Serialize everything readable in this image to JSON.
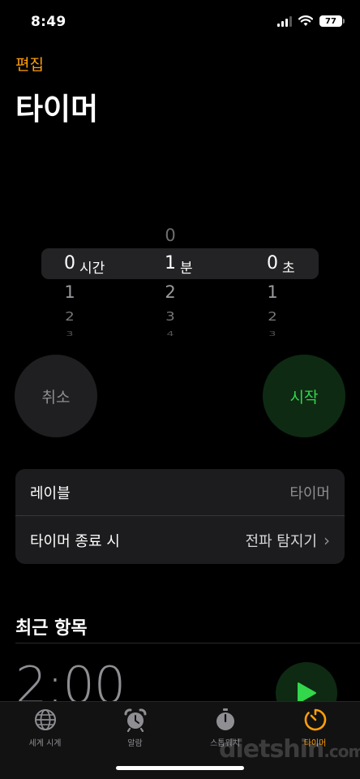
{
  "status_bar": {
    "time": "8:49",
    "battery": "77"
  },
  "header": {
    "edit_label": "편집",
    "title": "타이머"
  },
  "picker": {
    "hours": {
      "prev": "",
      "selected": "0",
      "next": [
        "1",
        "2",
        "3"
      ],
      "unit": "시간"
    },
    "minutes": {
      "prev": "0",
      "selected": "1",
      "next": [
        "2",
        "3",
        "4"
      ],
      "unit": "분"
    },
    "seconds": {
      "prev": "",
      "selected": "0",
      "next": [
        "1",
        "2",
        "3"
      ],
      "unit": "초"
    }
  },
  "buttons": {
    "cancel": "취소",
    "start": "시작"
  },
  "settings": {
    "label_title": "레이블",
    "label_value": "타이머",
    "end_title": "타이머 종료 시",
    "end_value": "전파 탐지기",
    "chevron": "›"
  },
  "recent": {
    "title": "최근 항목",
    "time": "2:00"
  },
  "tabs": [
    {
      "label": "세계 시계",
      "icon": "globe-icon",
      "active": false
    },
    {
      "label": "알람",
      "icon": "alarm-clock-icon",
      "active": false
    },
    {
      "label": "스톱워치",
      "icon": "stopwatch-icon",
      "active": false
    },
    {
      "label": "타이머",
      "icon": "timer-icon",
      "active": true
    }
  ],
  "watermark": {
    "main": "dietshin",
    "suffix": ".com"
  },
  "colors": {
    "accent": "#ff9f0a",
    "start_green": "#32d74b",
    "background": "#000000"
  }
}
